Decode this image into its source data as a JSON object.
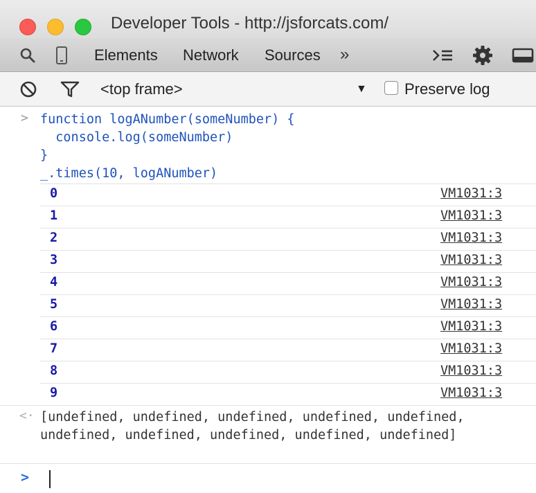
{
  "window": {
    "title": "Developer Tools - http://jsforcats.com/"
  },
  "toolbar": {
    "tabs": [
      "Elements",
      "Network",
      "Sources"
    ],
    "more_tabs_label": "»",
    "icons": [
      "search-icon",
      "device-mode-icon",
      "console-drawer-icon",
      "gear-icon",
      "dock-icon"
    ]
  },
  "console_toolbar": {
    "frame_select": "<top frame>",
    "preserve_log_label": "Preserve log",
    "preserve_log_checked": false,
    "icons": [
      "clear-console-icon",
      "filter-icon"
    ]
  },
  "console": {
    "input_prompt": ">",
    "result_prompt": "<·",
    "code_lines": [
      "function logANumber(someNumber) {",
      "  console.log(someNumber)",
      "}",
      "_.times(10, logANumber)"
    ],
    "log_rows": [
      {
        "value": "0",
        "source": "VM1031:3"
      },
      {
        "value": "1",
        "source": "VM1031:3"
      },
      {
        "value": "2",
        "source": "VM1031:3"
      },
      {
        "value": "3",
        "source": "VM1031:3"
      },
      {
        "value": "4",
        "source": "VM1031:3"
      },
      {
        "value": "5",
        "source": "VM1031:3"
      },
      {
        "value": "6",
        "source": "VM1031:3"
      },
      {
        "value": "7",
        "source": "VM1031:3"
      },
      {
        "value": "8",
        "source": "VM1031:3"
      },
      {
        "value": "9",
        "source": "VM1031:3"
      }
    ],
    "result_text": "[undefined, undefined, undefined, undefined, undefined, undefined, undefined, undefined, undefined, undefined]",
    "input_value": "",
    "colors": {
      "code": "#1f53bb",
      "log_value": "#1a1aa6",
      "input_prompt": "#2f6fdd"
    }
  }
}
